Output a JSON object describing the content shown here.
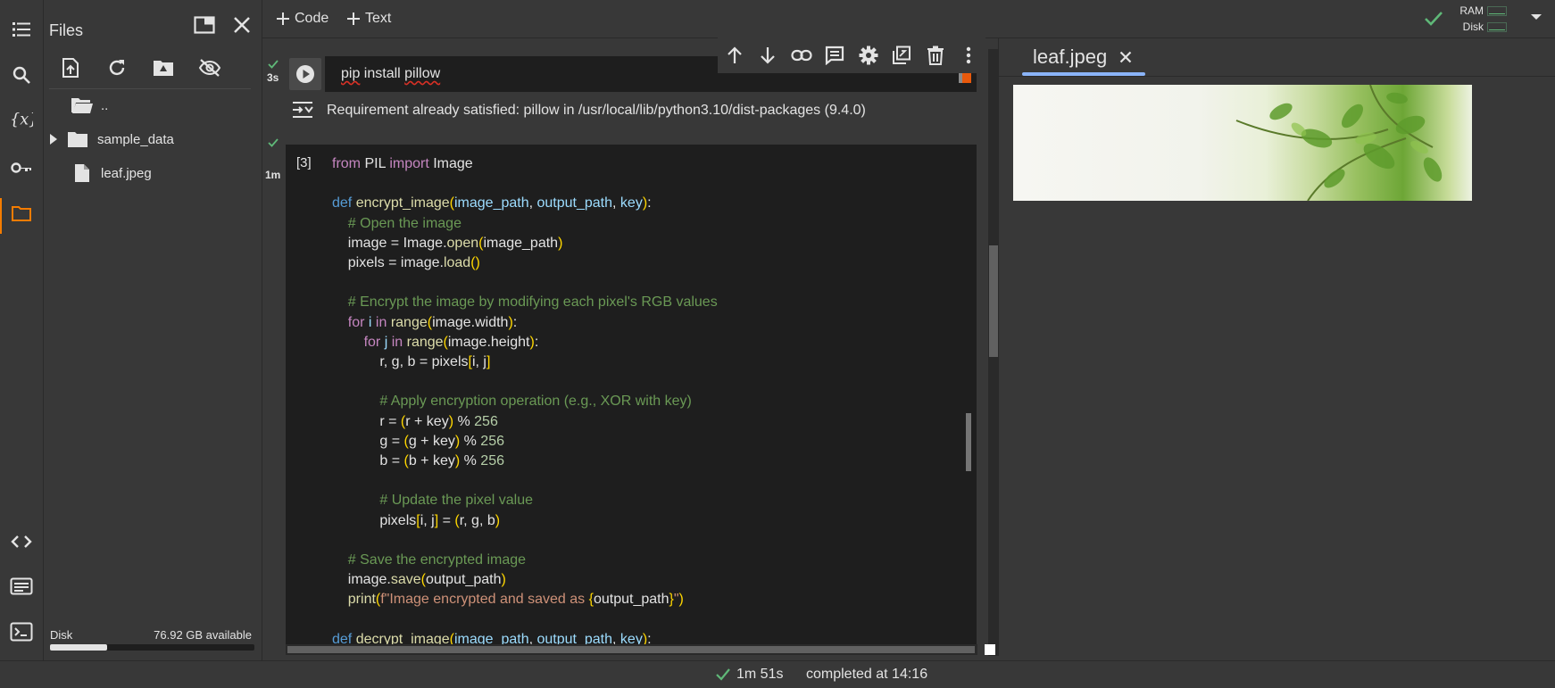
{
  "sidebar": {
    "icons": [
      "table-of-contents-icon",
      "search-icon",
      "variables-icon",
      "secrets-key-icon",
      "folder-icon",
      "code-snippets-icon",
      "command-palette-icon",
      "terminal-icon"
    ],
    "active_color": "#f57c00"
  },
  "files_panel": {
    "title": "Files",
    "tree": [
      {
        "label": ".."
      },
      {
        "label": "sample_data"
      },
      {
        "label": "leaf.jpeg"
      }
    ],
    "disk_label": "Disk",
    "disk_available": "76.92 GB available",
    "disk_used_fraction": 0.28
  },
  "toolbar": {
    "add_code_label": "Code",
    "add_text_label": "Text",
    "ram_label": "RAM",
    "disk_label": "Disk",
    "connected_color": "#5fb878"
  },
  "cells": {
    "cell1": {
      "duration": "3s",
      "source": "pip install pillow",
      "source_pip": "pip",
      "source_install": " install ",
      "source_pillow": "pillow",
      "output": "Requirement already satisfied: pillow in /usr/local/lib/python3.10/dist-packages (9.4.0)"
    },
    "cell2": {
      "execution_count": "[3]",
      "duration": "1m"
    }
  },
  "viewer": {
    "tab_label": "leaf.jpeg"
  },
  "statusbar": {
    "duration": "1m 51s",
    "completed": "completed at 14:16"
  }
}
